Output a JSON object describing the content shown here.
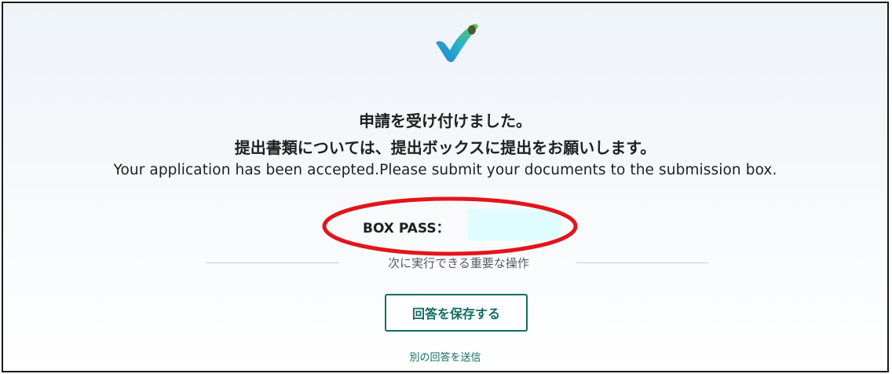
{
  "confirmation": {
    "title_ja": "申請を受け付けました。",
    "instruction_ja": "提出書類については、提出ボックスに提出をお願いします。",
    "message_en": "Your application has been accepted.Please submit your documents to the submission box."
  },
  "box_pass": {
    "label": "BOX PASS：",
    "value": ""
  },
  "next_actions": {
    "heading": "次に実行できる重要な操作",
    "save_button_label": "回答を保存する",
    "submit_another_label": "別の回答を送信"
  },
  "icons": {
    "success": "checkmark-icon"
  },
  "colors": {
    "accent": "#0f6c62",
    "annotation_ellipse": "#e3141b",
    "pass_field_bg": "#dffcff",
    "check_gradient_start": "#2bb3c9",
    "check_gradient_end": "#6cc24a"
  }
}
